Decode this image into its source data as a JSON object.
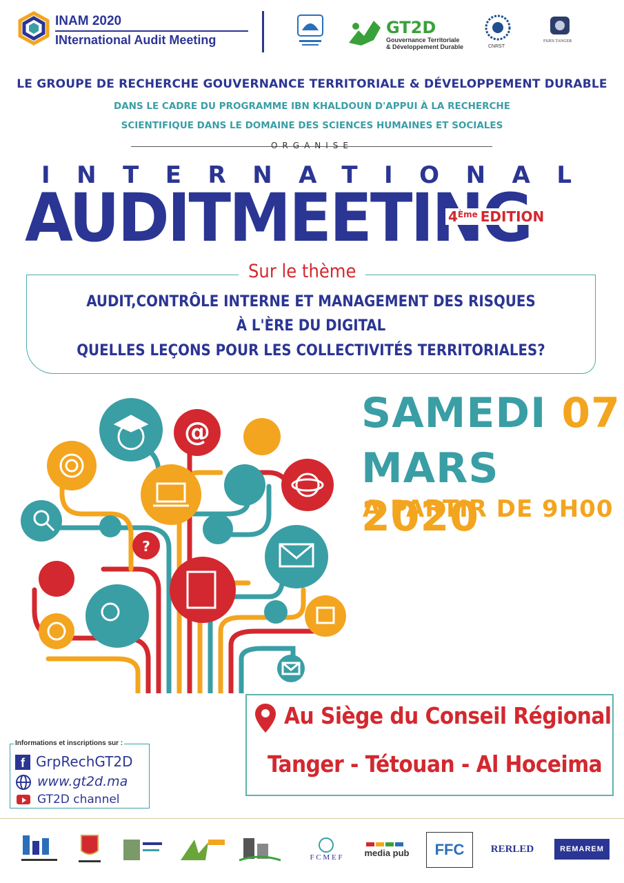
{
  "header": {
    "brand_line1": "INAM 2020",
    "brand_line2": "INternational Audit Meeting",
    "gt2d_title": "GT2D",
    "gt2d_sub1": "Gouvernance Territoriale",
    "gt2d_sub2": "& Développement Durable",
    "cnrst_label": "CNRST",
    "fsjes_label": "FSJES TANGER"
  },
  "organizer": {
    "line1": "LE GROUPE DE RECHERCHE GOUVERNANCE TERRITORIALE & DÉVELOPPEMENT DURABLE",
    "line2": "DANS LE CADRE DU PROGRAMME IBN KHALDOUN D'APPUI À LA RECHERCHE",
    "line3": "SCIENTIFIQUE DANS LE DOMAINE DES SCIENCES HUMAINES ET SOCIALES",
    "organise": "ORGANISE"
  },
  "title": {
    "international": "INTERNATIONAL",
    "audit_meeting": "AUDITMEETING",
    "edition_num": "4",
    "edition_sup": "Ème",
    "edition_word": "EDITION"
  },
  "theme": {
    "heading": "Sur le thème",
    "line1": "AUDIT,CONTRÔLE INTERNE ET MANAGEMENT DES RISQUES",
    "line2": "À L'ÈRE DU DIGITAL",
    "line3": "QUELLES LEÇONS POUR LES COLLECTIVITÉS TERRITORIALES?"
  },
  "date": {
    "day_name": "SAMEDI",
    "day_num": "07",
    "month": "MARS",
    "year": "2020",
    "time": "A PARTIR DE 9H00"
  },
  "venue": {
    "line1": "Au Siège du Conseil Régional",
    "line2": "Tanger - Tétouan - Al Hoceima"
  },
  "info": {
    "heading": "Informations et inscriptions sur :",
    "facebook": "GrpRechGT2D",
    "website": "www.gt2d.ma",
    "youtube": "GT2D channel"
  },
  "sponsors": {
    "fcmef": "F C M E F",
    "mediapub": "media pub",
    "ffc": "FFC",
    "rerled": "RERLED",
    "remarem": "REMAREM"
  },
  "colors": {
    "navy": "#2b3593",
    "teal": "#3a9ea5",
    "orange": "#f3a51f",
    "red": "#d3282f"
  }
}
